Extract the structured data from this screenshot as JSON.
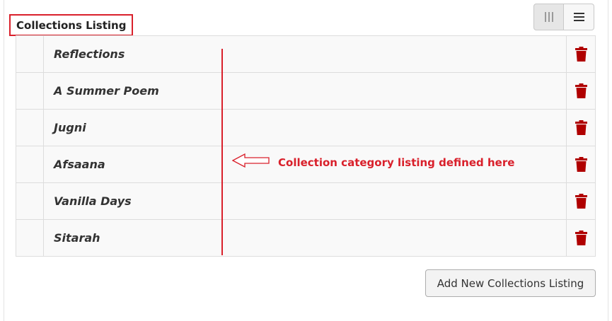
{
  "header": {
    "title": "Collections Listing"
  },
  "view_toggle": {
    "left_icon": "columns-icon",
    "right_icon": "list-icon"
  },
  "collections": {
    "items": [
      {
        "title": "Reflections"
      },
      {
        "title": "A Summer Poem"
      },
      {
        "title": "Jugni"
      },
      {
        "title": "Afsaana"
      },
      {
        "title": "Vanilla Days"
      },
      {
        "title": "Sitarah"
      }
    ],
    "action_icon": "trash-icon"
  },
  "annotation": {
    "text": "Collection category listing defined here",
    "color": "#d9202b"
  },
  "footer": {
    "add_button_label": "Add New Collections Listing"
  },
  "colors": {
    "trash": "#b00000",
    "annotation": "#d9202b"
  }
}
